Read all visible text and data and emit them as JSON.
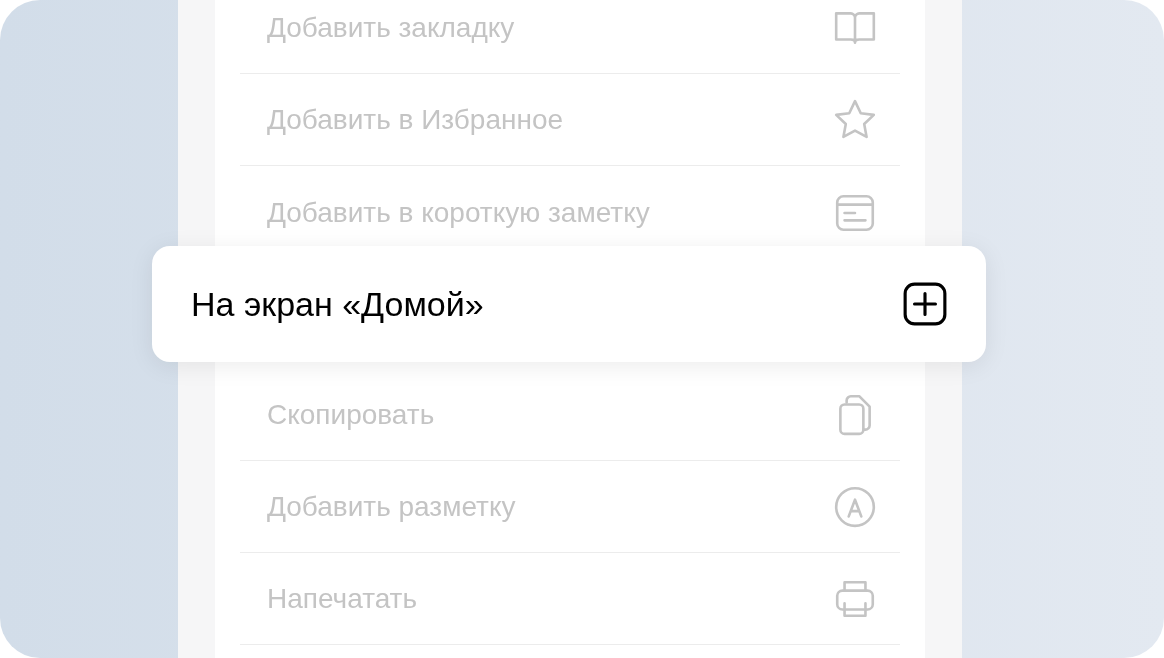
{
  "menu_groups": [
    {
      "items": [
        {
          "label": "Добавить закладку",
          "dimmed": true
        },
        {
          "label": "Добавить в Избранное",
          "dimmed": true
        },
        {
          "label": "Добавить в короткую заметку",
          "dimmed": true
        }
      ]
    },
    {
      "items": [
        {
          "label": "Скопировать",
          "dimmed": true
        },
        {
          "label": "Добавить разметку",
          "dimmed": true
        },
        {
          "label": "Напечатать",
          "dimmed": true
        }
      ]
    }
  ],
  "highlighted_item": {
    "label": "На экран «Домой»"
  }
}
